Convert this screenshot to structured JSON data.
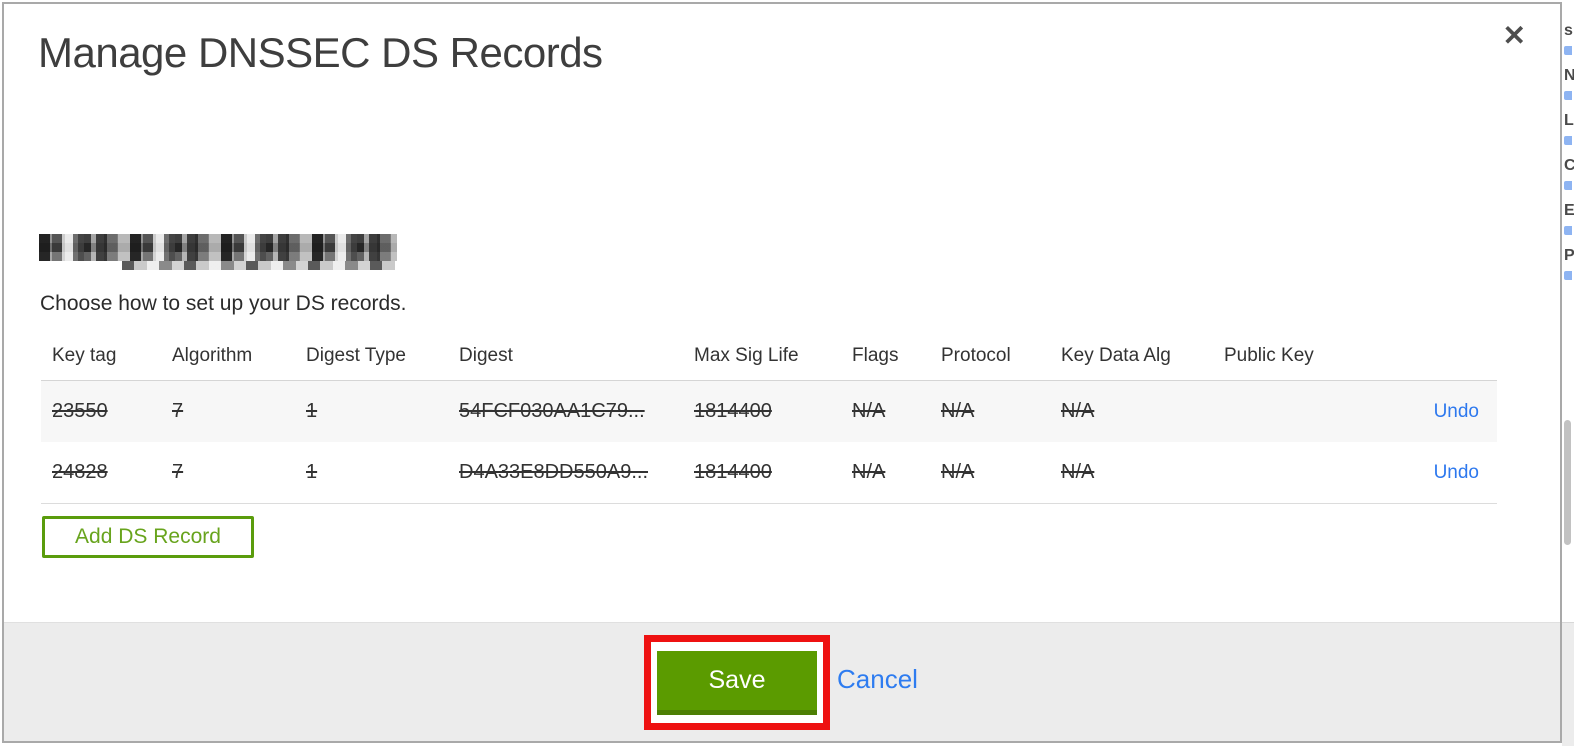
{
  "modal": {
    "title": "Manage DNSSEC DS Records",
    "close_glyph": "✕",
    "domain_redacted": true,
    "instruction": "Choose how to set up your DS records.",
    "table": {
      "columns": [
        "Key tag",
        "Algorithm",
        "Digest Type",
        "Digest",
        "Max Sig Life",
        "Flags",
        "Protocol",
        "Key Data Alg",
        "Public Key"
      ],
      "rows": [
        {
          "key_tag": "23550",
          "algorithm": "7",
          "digest_type": "1",
          "digest": "54FCF030AA1C79...",
          "max_sig_life": "1814400",
          "flags": "N/A",
          "protocol": "N/A",
          "key_data_alg": "N/A",
          "public_key": "",
          "undo_label": "Undo",
          "state": "marked-for-deletion"
        },
        {
          "key_tag": "24828",
          "algorithm": "7",
          "digest_type": "1",
          "digest": "D4A33E8DD550A9...",
          "max_sig_life": "1814400",
          "flags": "N/A",
          "protocol": "N/A",
          "key_data_alg": "N/A",
          "public_key": "",
          "undo_label": "Undo",
          "state": "marked-for-deletion"
        }
      ]
    },
    "add_ds_record_label": "Add DS Record",
    "footer": {
      "save_label": "Save",
      "cancel_label": "Cancel"
    }
  },
  "annotation": {
    "highlight_color": "#ee1111",
    "highlighted_element": "save-button"
  },
  "colors": {
    "save_green": "#5b9b00",
    "save_green_edge": "#4c7f04",
    "add_button_green": "#5a9c0c",
    "link_blue": "#2d78ee",
    "footer_gray": "#ececec"
  },
  "background_page_edge": {
    "letter_fragments": [
      "s",
      "N",
      "L",
      "C",
      "E",
      "P"
    ]
  }
}
